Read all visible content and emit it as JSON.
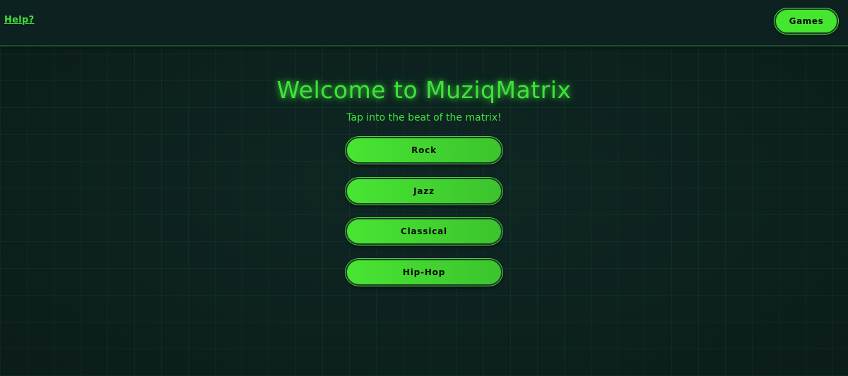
{
  "header": {
    "help_label": "Help?",
    "games_label": "Games"
  },
  "main": {
    "title": "Welcome to MuziqMatrix",
    "subtitle": "Tap into the beat of the matrix!",
    "genres": [
      {
        "label": "Rock"
      },
      {
        "label": "Jazz"
      },
      {
        "label": "Classical"
      },
      {
        "label": "Hip-Hop"
      }
    ]
  },
  "colors": {
    "accent": "#45e62f",
    "background": "#0c1f1d",
    "text_on_accent": "#0a0a0a"
  }
}
